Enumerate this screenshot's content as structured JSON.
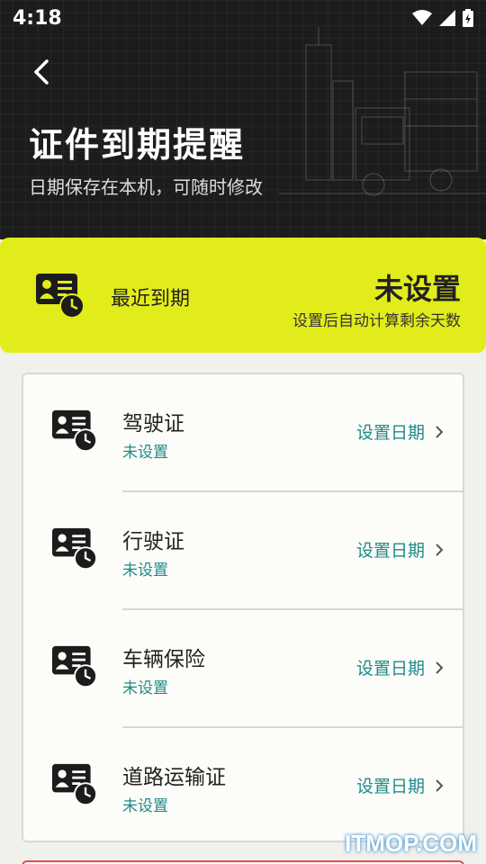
{
  "status_bar": {
    "time": "4:18"
  },
  "header": {
    "title": "证件到期提醒",
    "subtitle": "日期保存在本机，可随时修改"
  },
  "summary": {
    "label": "最近到期",
    "value": "未设置",
    "hint": "设置后自动计算剩余天数"
  },
  "documents": [
    {
      "name": "驾驶证",
      "status": "未设置",
      "action": "设置日期"
    },
    {
      "name": "行驶证",
      "status": "未设置",
      "action": "设置日期"
    },
    {
      "name": "车辆保险",
      "status": "未设置",
      "action": "设置日期"
    },
    {
      "name": "道路运输证",
      "status": "未设置",
      "action": "设置日期"
    }
  ],
  "watermark": "ITMOP.COM",
  "colors": {
    "accent": "#e3ec1b",
    "teal": "#1e8a8a",
    "header_bg": "#1c1c1c"
  },
  "icons": [
    "back-arrow-icon",
    "wifi-icon",
    "signal-icon",
    "battery-icon",
    "id-card-clock-icon",
    "chevron-right-icon"
  ]
}
